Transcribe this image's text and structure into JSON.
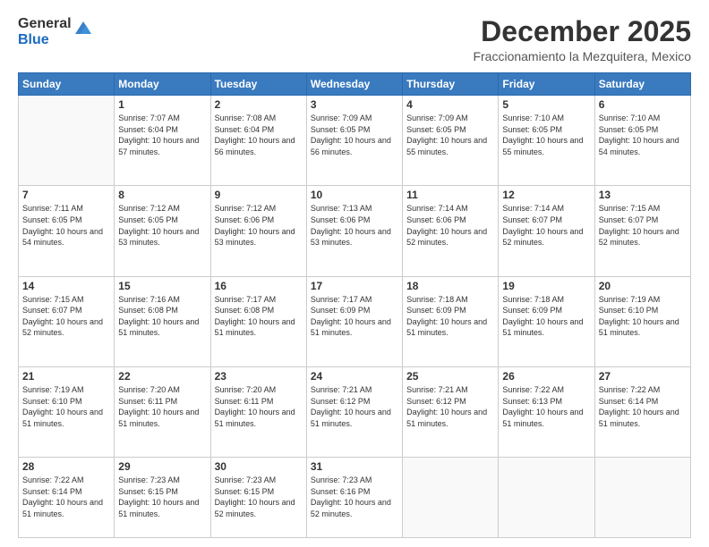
{
  "logo": {
    "general": "General",
    "blue": "Blue"
  },
  "header": {
    "month": "December 2025",
    "location": "Fraccionamiento la Mezquitera, Mexico"
  },
  "days_header": [
    "Sunday",
    "Monday",
    "Tuesday",
    "Wednesday",
    "Thursday",
    "Friday",
    "Saturday"
  ],
  "weeks": [
    [
      {
        "day": "",
        "sunrise": "",
        "sunset": "",
        "daylight": ""
      },
      {
        "day": "1",
        "sunrise": "Sunrise: 7:07 AM",
        "sunset": "Sunset: 6:04 PM",
        "daylight": "Daylight: 10 hours and 57 minutes."
      },
      {
        "day": "2",
        "sunrise": "Sunrise: 7:08 AM",
        "sunset": "Sunset: 6:04 PM",
        "daylight": "Daylight: 10 hours and 56 minutes."
      },
      {
        "day": "3",
        "sunrise": "Sunrise: 7:09 AM",
        "sunset": "Sunset: 6:05 PM",
        "daylight": "Daylight: 10 hours and 56 minutes."
      },
      {
        "day": "4",
        "sunrise": "Sunrise: 7:09 AM",
        "sunset": "Sunset: 6:05 PM",
        "daylight": "Daylight: 10 hours and 55 minutes."
      },
      {
        "day": "5",
        "sunrise": "Sunrise: 7:10 AM",
        "sunset": "Sunset: 6:05 PM",
        "daylight": "Daylight: 10 hours and 55 minutes."
      },
      {
        "day": "6",
        "sunrise": "Sunrise: 7:10 AM",
        "sunset": "Sunset: 6:05 PM",
        "daylight": "Daylight: 10 hours and 54 minutes."
      }
    ],
    [
      {
        "day": "7",
        "sunrise": "Sunrise: 7:11 AM",
        "sunset": "Sunset: 6:05 PM",
        "daylight": "Daylight: 10 hours and 54 minutes."
      },
      {
        "day": "8",
        "sunrise": "Sunrise: 7:12 AM",
        "sunset": "Sunset: 6:05 PM",
        "daylight": "Daylight: 10 hours and 53 minutes."
      },
      {
        "day": "9",
        "sunrise": "Sunrise: 7:12 AM",
        "sunset": "Sunset: 6:06 PM",
        "daylight": "Daylight: 10 hours and 53 minutes."
      },
      {
        "day": "10",
        "sunrise": "Sunrise: 7:13 AM",
        "sunset": "Sunset: 6:06 PM",
        "daylight": "Daylight: 10 hours and 53 minutes."
      },
      {
        "day": "11",
        "sunrise": "Sunrise: 7:14 AM",
        "sunset": "Sunset: 6:06 PM",
        "daylight": "Daylight: 10 hours and 52 minutes."
      },
      {
        "day": "12",
        "sunrise": "Sunrise: 7:14 AM",
        "sunset": "Sunset: 6:07 PM",
        "daylight": "Daylight: 10 hours and 52 minutes."
      },
      {
        "day": "13",
        "sunrise": "Sunrise: 7:15 AM",
        "sunset": "Sunset: 6:07 PM",
        "daylight": "Daylight: 10 hours and 52 minutes."
      }
    ],
    [
      {
        "day": "14",
        "sunrise": "Sunrise: 7:15 AM",
        "sunset": "Sunset: 6:07 PM",
        "daylight": "Daylight: 10 hours and 52 minutes."
      },
      {
        "day": "15",
        "sunrise": "Sunrise: 7:16 AM",
        "sunset": "Sunset: 6:08 PM",
        "daylight": "Daylight: 10 hours and 51 minutes."
      },
      {
        "day": "16",
        "sunrise": "Sunrise: 7:17 AM",
        "sunset": "Sunset: 6:08 PM",
        "daylight": "Daylight: 10 hours and 51 minutes."
      },
      {
        "day": "17",
        "sunrise": "Sunrise: 7:17 AM",
        "sunset": "Sunset: 6:09 PM",
        "daylight": "Daylight: 10 hours and 51 minutes."
      },
      {
        "day": "18",
        "sunrise": "Sunrise: 7:18 AM",
        "sunset": "Sunset: 6:09 PM",
        "daylight": "Daylight: 10 hours and 51 minutes."
      },
      {
        "day": "19",
        "sunrise": "Sunrise: 7:18 AM",
        "sunset": "Sunset: 6:09 PM",
        "daylight": "Daylight: 10 hours and 51 minutes."
      },
      {
        "day": "20",
        "sunrise": "Sunrise: 7:19 AM",
        "sunset": "Sunset: 6:10 PM",
        "daylight": "Daylight: 10 hours and 51 minutes."
      }
    ],
    [
      {
        "day": "21",
        "sunrise": "Sunrise: 7:19 AM",
        "sunset": "Sunset: 6:10 PM",
        "daylight": "Daylight: 10 hours and 51 minutes."
      },
      {
        "day": "22",
        "sunrise": "Sunrise: 7:20 AM",
        "sunset": "Sunset: 6:11 PM",
        "daylight": "Daylight: 10 hours and 51 minutes."
      },
      {
        "day": "23",
        "sunrise": "Sunrise: 7:20 AM",
        "sunset": "Sunset: 6:11 PM",
        "daylight": "Daylight: 10 hours and 51 minutes."
      },
      {
        "day": "24",
        "sunrise": "Sunrise: 7:21 AM",
        "sunset": "Sunset: 6:12 PM",
        "daylight": "Daylight: 10 hours and 51 minutes."
      },
      {
        "day": "25",
        "sunrise": "Sunrise: 7:21 AM",
        "sunset": "Sunset: 6:12 PM",
        "daylight": "Daylight: 10 hours and 51 minutes."
      },
      {
        "day": "26",
        "sunrise": "Sunrise: 7:22 AM",
        "sunset": "Sunset: 6:13 PM",
        "daylight": "Daylight: 10 hours and 51 minutes."
      },
      {
        "day": "27",
        "sunrise": "Sunrise: 7:22 AM",
        "sunset": "Sunset: 6:14 PM",
        "daylight": "Daylight: 10 hours and 51 minutes."
      }
    ],
    [
      {
        "day": "28",
        "sunrise": "Sunrise: 7:22 AM",
        "sunset": "Sunset: 6:14 PM",
        "daylight": "Daylight: 10 hours and 51 minutes."
      },
      {
        "day": "29",
        "sunrise": "Sunrise: 7:23 AM",
        "sunset": "Sunset: 6:15 PM",
        "daylight": "Daylight: 10 hours and 51 minutes."
      },
      {
        "day": "30",
        "sunrise": "Sunrise: 7:23 AM",
        "sunset": "Sunset: 6:15 PM",
        "daylight": "Daylight: 10 hours and 52 minutes."
      },
      {
        "day": "31",
        "sunrise": "Sunrise: 7:23 AM",
        "sunset": "Sunset: 6:16 PM",
        "daylight": "Daylight: 10 hours and 52 minutes."
      },
      {
        "day": "",
        "sunrise": "",
        "sunset": "",
        "daylight": ""
      },
      {
        "day": "",
        "sunrise": "",
        "sunset": "",
        "daylight": ""
      },
      {
        "day": "",
        "sunrise": "",
        "sunset": "",
        "daylight": ""
      }
    ]
  ]
}
